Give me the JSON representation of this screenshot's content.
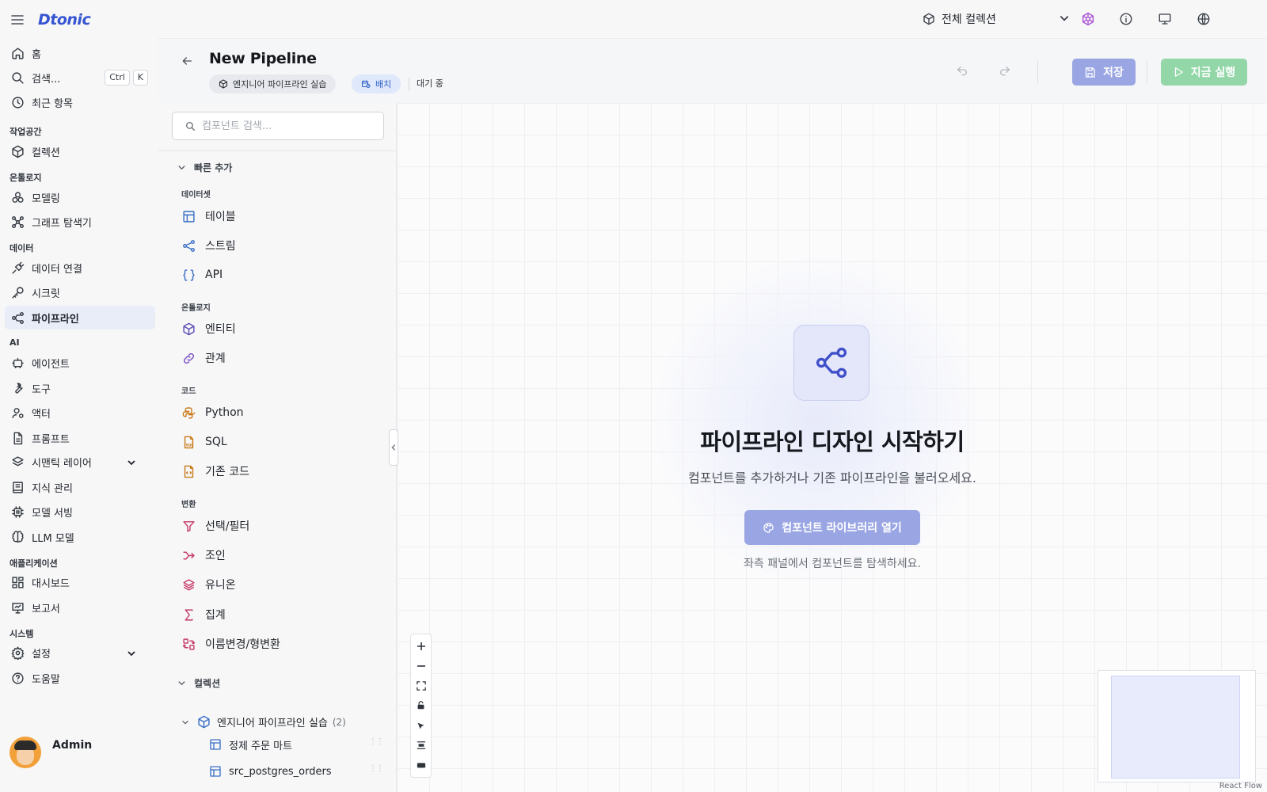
{
  "brand": {
    "logo_text": "Dtonic"
  },
  "sidebar": {
    "home": "홈",
    "search": "검색...",
    "shortcut_keys": [
      "Ctrl",
      "K"
    ],
    "recent": "최근 항목",
    "sections": {
      "workspace": "작업공간",
      "ontology": "온톨로지",
      "data": "데이터",
      "ai": "AI",
      "applications": "애플리케이션",
      "system": "시스템"
    },
    "items": {
      "collections": "컬렉션",
      "modeling": "모델링",
      "graph_explorer": "그래프 탐색기",
      "data_connections": "데이터 연결",
      "secrets": "시크릿",
      "pipelines": "파이프라인",
      "agents": "에이전트",
      "tools": "도구",
      "actors": "액터",
      "prompts": "프롬프트",
      "semantic_layer": "시맨틱 레이어",
      "knowledge": "지식 관리",
      "model_serving": "모델 서빙",
      "llm_models": "LLM 모델",
      "dashboards": "대시보드",
      "reports": "보고서",
      "settings": "설정",
      "help": "도움말"
    },
    "user_name": "Admin"
  },
  "topbar": {
    "collection_select": "전체 컬렉션",
    "icons": [
      "ai-assistant-icon",
      "info-icon",
      "monitor-icon",
      "globe-icon"
    ]
  },
  "pipeline": {
    "title": "New Pipeline",
    "collection_chip": "엔지니어 파이프라인 실습",
    "mode_chip": "배치",
    "status": "대기 중",
    "save_label": "저장",
    "run_label": "지금 실행"
  },
  "panel": {
    "search_placeholder": "컴포넌트 검색...",
    "quick_add": "빠른 추가",
    "categories": {
      "datasets": "데이터셋",
      "ontology": "온톨로지",
      "code": "코드",
      "transform": "변환"
    },
    "components": {
      "table": "테이블",
      "stream": "스트림",
      "api": "API",
      "entity": "엔티티",
      "relation": "관계",
      "python": "Python",
      "sql": "SQL",
      "existing_code": "기존 코드",
      "select_filter": "선택/필터",
      "join": "조인",
      "union": "유니온",
      "aggregate": "집계",
      "rename_cast": "이름변경/형변환"
    },
    "collections_group": "컬렉션",
    "collection": {
      "name": "엔지니어 파이프라인 실습",
      "count": "(2)"
    },
    "collection_items": [
      "정제 주문 마트",
      "src_postgres_orders"
    ]
  },
  "canvas": {
    "title": "파이프라인 디자인 시작하기",
    "subtitle": "컴포넌트를 추가하거나 기존 파이프라인을 불러오세요.",
    "open_library_label": "컴포넌트 라이브러리 열기",
    "hint": "좌측 패널에서 컴포넌트를 탐색하세요.",
    "attribution": "React Flow"
  },
  "colors": {
    "accent": "#3554d1",
    "save_button": "#9aa6e3",
    "run_button": "#93d7a9",
    "active_nav": "#e8edf8"
  }
}
